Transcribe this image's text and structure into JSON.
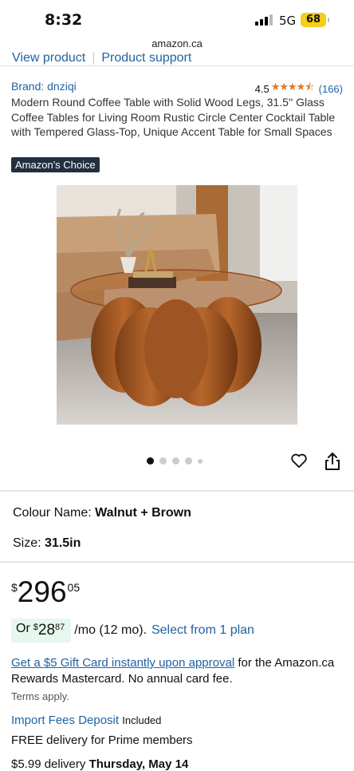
{
  "status": {
    "time": "8:32",
    "network": "5G",
    "battery": "68"
  },
  "url": "amazon.ca",
  "top_links": {
    "view_product": "View product",
    "product_support": "Product support"
  },
  "product": {
    "brand": "Brand: dnziqi",
    "rating": "4.5",
    "stars": "★★★★⯪",
    "review_count": "(166)",
    "title": "Modern Round Coffee Table with Solid Wood Legs, 31.5'' Glass Coffee Tables for Living Room Rustic Circle Center Cocktail Table with Tempered Glass-Top, Unique Accent Table for Small Spaces",
    "badge": "Amazon's Choice"
  },
  "options": {
    "colour_label": "Colour Name:",
    "colour_value": "Walnut + Brown",
    "size_label": "Size:",
    "size_value": "31.5in"
  },
  "price": {
    "symbol": "$",
    "whole": "296",
    "fraction": "05"
  },
  "monthly": {
    "or": "Or",
    "symbol": "$",
    "whole": "28",
    "fraction": "87",
    "term": "/mo (12 mo).",
    "plan_link": "Select from 1 plan"
  },
  "gift": {
    "link": "Get a $5 Gift Card instantly upon approval",
    "text": " for the Amazon.ca Rewards Mastercard. No annual card fee.",
    "terms": "Terms apply."
  },
  "import": {
    "link": "Import Fees Deposit",
    "included": "Included"
  },
  "free_delivery": "FREE delivery for Prime members",
  "delivery": {
    "prefix": "$5.99 delivery ",
    "date": "Thursday, May 14"
  },
  "icons": {
    "heart": "heart-icon",
    "share": "share-icon"
  }
}
